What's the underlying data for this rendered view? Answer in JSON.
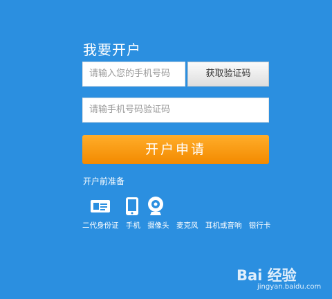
{
  "form": {
    "title": "我要开户",
    "phone_placeholder": "请输入您的手机号码",
    "get_code_label": "获取验证码",
    "sms_placeholder": "请输手机号码验证码",
    "submit_label": "开户申请"
  },
  "preparation": {
    "label": "开户前准备",
    "icons": [
      "id-card-icon",
      "phone-icon",
      "webcam-icon"
    ],
    "items": [
      "二代身份证",
      "手机",
      "摄像头",
      "麦克风",
      "耳机或音响",
      "银行卡"
    ]
  },
  "colors": {
    "background": "#2b8fe0",
    "submit": "#f7941d",
    "field": "#ffffff"
  },
  "watermark": {
    "logo_text": "Bai 经验",
    "url": "jingyan.baidu.com"
  }
}
